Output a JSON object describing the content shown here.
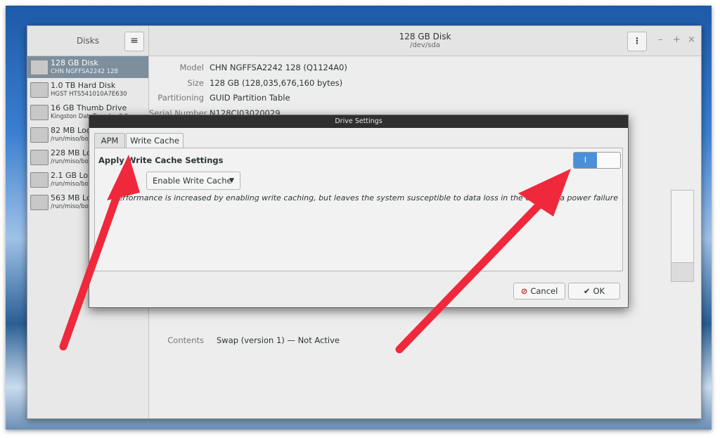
{
  "window": {
    "sidebar_title": "Disks",
    "sidebar_menu_icon": "hamburger-menu-icon",
    "title": "128 GB Disk",
    "subtitle": "/dev/sda",
    "min_glyph": "–",
    "max_glyph": "+",
    "close_glyph": "×"
  },
  "devices": [
    {
      "name": "128 GB Disk",
      "detail": "CHN NGFFSA2242 128"
    },
    {
      "name": "1.0 TB Hard Disk",
      "detail": "HGST HTS541010A7E630"
    },
    {
      "name": "16 GB Thumb Drive",
      "detail": "Kingston DataTraveler 3.0"
    },
    {
      "name": "82 MB Loop",
      "detail": "/run/miso/boo"
    },
    {
      "name": "228 MB Loop",
      "detail": "/run/miso/boo"
    },
    {
      "name": "2.1 GB Loop",
      "detail": "/run/miso/boo"
    },
    {
      "name": "563 MB Loop",
      "detail": "/run/miso/boo"
    }
  ],
  "disk_info": {
    "model_label": "Model",
    "model": "CHN NGFFSA2242 128 (Q1124A0)",
    "size_label": "Size",
    "size": "128 GB (128,035,676,160 bytes)",
    "partitioning_label": "Partitioning",
    "partitioning": "GUID Partition Table",
    "serial_label": "Serial Number",
    "serial": "N128CJ03020029",
    "contents_label": "Contents",
    "contents": "Swap (version 1) — Not Active"
  },
  "dialog": {
    "title": "Drive Settings",
    "tabs": [
      "APM",
      "Write Cache"
    ],
    "active_tab": "Write Cache",
    "section_title": "Apply Write Cache Settings",
    "switch_on_label": "I",
    "switch_state": "on",
    "combo_value": "Enable Write Cache",
    "note": "Performance is increased by enabling write caching, but leaves the system susceptible to data loss in the event of a power failure",
    "cancel_label": "Cancel",
    "ok_label": "OK"
  },
  "colors": {
    "accent": "#4a90d9",
    "annotation_arrow": "#f0283c",
    "selected_row": "#7d8e9d"
  }
}
